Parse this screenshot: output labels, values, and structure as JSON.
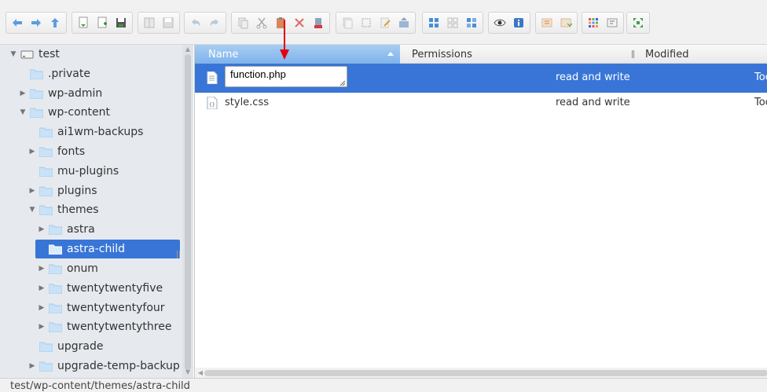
{
  "toolbar": {
    "groups": [
      [
        "back-icon",
        "forward-icon",
        "up-icon"
      ],
      [
        "open-icon",
        "new-file-icon",
        "save-icon"
      ],
      [
        "copy-doc-icon",
        "save-as-icon"
      ],
      [
        "undo-icon",
        "redo-icon"
      ],
      [
        "copy-icon",
        "cut-icon",
        "paste-icon",
        "delete-icon",
        "trash-icon"
      ],
      [
        "duplicate-icon",
        "select-icon",
        "edit-icon",
        "extract-icon"
      ],
      [
        "view-large-icon",
        "view-grid-icon",
        "view-small-icon"
      ],
      [
        "preview-icon",
        "info-icon"
      ],
      [
        "move-icon",
        "move-down-icon"
      ],
      [
        "grid-icon",
        "rename-icon"
      ],
      [
        "fullscreen-icon"
      ]
    ]
  },
  "tree": {
    "items": [
      {
        "label": "test",
        "expanded": true,
        "level": 0,
        "kind": "drive"
      },
      {
        "label": ".private",
        "level": 1
      },
      {
        "label": "wp-admin",
        "level": 1,
        "collapsed": true
      },
      {
        "label": "wp-content",
        "level": 1,
        "expanded": true
      },
      {
        "label": "ai1wm-backups",
        "level": 2
      },
      {
        "label": "fonts",
        "level": 2,
        "collapsed": true
      },
      {
        "label": "mu-plugins",
        "level": 2
      },
      {
        "label": "plugins",
        "level": 2,
        "collapsed": true
      },
      {
        "label": "themes",
        "level": 2,
        "expanded": true
      },
      {
        "label": "astra",
        "level": 3,
        "collapsed": true
      },
      {
        "label": "astra-child",
        "level": 3,
        "selected": true
      },
      {
        "label": "onum",
        "level": 3,
        "collapsed": true
      },
      {
        "label": "twentytwentyfive",
        "level": 3,
        "collapsed": true
      },
      {
        "label": "twentytwentyfour",
        "level": 3,
        "collapsed": true
      },
      {
        "label": "twentytwentythree",
        "level": 3,
        "collapsed": true
      },
      {
        "label": "upgrade",
        "level": 2
      },
      {
        "label": "upgrade-temp-backup",
        "level": 2,
        "collapsed": true
      }
    ]
  },
  "list": {
    "columns": {
      "name": "Name",
      "permissions": "Permissions",
      "modified": "Modified"
    },
    "rows": [
      {
        "name": "function.php",
        "permissions": "read and write",
        "modified": "Toc",
        "editing": true
      },
      {
        "name": "style.css",
        "permissions": "read and write",
        "modified": "Toc"
      }
    ],
    "rename_value": "function.php"
  },
  "status": {
    "path": "test/wp-content/themes/astra-child"
  },
  "colors": {
    "selection": "#3875d7",
    "header_active": "#8bbbed",
    "arrow": "#e0000f"
  }
}
